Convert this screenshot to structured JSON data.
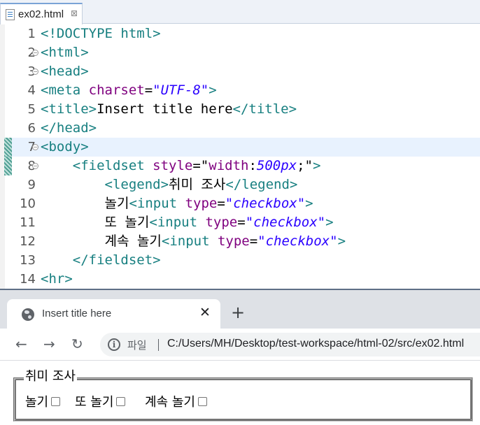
{
  "editor": {
    "file_tab": {
      "name": "ex02.html",
      "close": "⊠"
    },
    "lines": [
      {
        "num": "1",
        "parts": [
          {
            "c": "t-tag",
            "t": "<!DOCTYPE html>"
          }
        ]
      },
      {
        "num": "2",
        "fold": true,
        "parts": [
          {
            "c": "t-tag",
            "t": "<html>"
          }
        ]
      },
      {
        "num": "3",
        "fold": true,
        "parts": [
          {
            "c": "t-tag",
            "t": "<head>"
          }
        ]
      },
      {
        "num": "4",
        "parts": [
          {
            "c": "t-tag",
            "t": "<meta "
          },
          {
            "c": "t-attr",
            "t": "charset"
          },
          {
            "c": "t-plain",
            "t": "="
          },
          {
            "c": "t-val",
            "t": "\"UTF-8\""
          },
          {
            "c": "t-tag",
            "t": ">"
          }
        ]
      },
      {
        "num": "5",
        "parts": [
          {
            "c": "t-tag",
            "t": "<title>"
          },
          {
            "c": "t-txt",
            "t": "Insert title here"
          },
          {
            "c": "t-tag",
            "t": "</title>"
          }
        ]
      },
      {
        "num": "6",
        "parts": [
          {
            "c": "t-tag",
            "t": "</head>"
          }
        ]
      },
      {
        "num": "7",
        "fold": true,
        "current": true,
        "marked": true,
        "parts": [
          {
            "c": "t-tag",
            "t": "<body>"
          }
        ]
      },
      {
        "num": "8",
        "fold": true,
        "marked": true,
        "parts": [
          {
            "c": "t-plain",
            "t": "    "
          },
          {
            "c": "t-tag",
            "t": "<fieldset "
          },
          {
            "c": "t-attr",
            "t": "style"
          },
          {
            "c": "t-plain",
            "t": "=\""
          },
          {
            "c": "t-attr",
            "t": "width"
          },
          {
            "c": "t-plain",
            "t": ":"
          },
          {
            "c": "t-val",
            "t": "500px"
          },
          {
            "c": "t-plain",
            "t": ";\""
          },
          {
            "c": "t-tag",
            "t": ">"
          }
        ]
      },
      {
        "num": "9",
        "parts": [
          {
            "c": "t-plain",
            "t": "        "
          },
          {
            "c": "t-tag",
            "t": "<legend>"
          },
          {
            "c": "t-txt",
            "t": "취미 조사"
          },
          {
            "c": "t-tag",
            "t": "</legend>"
          }
        ]
      },
      {
        "num": "10",
        "parts": [
          {
            "c": "t-plain",
            "t": "        "
          },
          {
            "c": "t-txt",
            "t": "놀기"
          },
          {
            "c": "t-tag",
            "t": "<input "
          },
          {
            "c": "t-attr",
            "t": "type"
          },
          {
            "c": "t-plain",
            "t": "="
          },
          {
            "c": "t-val",
            "t": "\"checkbox\""
          },
          {
            "c": "t-tag",
            "t": ">"
          }
        ]
      },
      {
        "num": "11",
        "parts": [
          {
            "c": "t-plain",
            "t": "        "
          },
          {
            "c": "t-txt",
            "t": "또 놀기"
          },
          {
            "c": "t-tag",
            "t": "<input "
          },
          {
            "c": "t-attr",
            "t": "type"
          },
          {
            "c": "t-plain",
            "t": "="
          },
          {
            "c": "t-val",
            "t": "\"checkbox\""
          },
          {
            "c": "t-tag",
            "t": ">"
          }
        ]
      },
      {
        "num": "12",
        "parts": [
          {
            "c": "t-plain",
            "t": "        "
          },
          {
            "c": "t-txt",
            "t": "계속 놀기"
          },
          {
            "c": "t-tag",
            "t": "<input "
          },
          {
            "c": "t-attr",
            "t": "type"
          },
          {
            "c": "t-plain",
            "t": "="
          },
          {
            "c": "t-val",
            "t": "\"checkbox\""
          },
          {
            "c": "t-tag",
            "t": ">"
          }
        ]
      },
      {
        "num": "13",
        "parts": [
          {
            "c": "t-plain",
            "t": "    "
          },
          {
            "c": "t-tag",
            "t": "</fieldset>"
          }
        ]
      },
      {
        "num": "14",
        "parts": [
          {
            "c": "t-tag",
            "t": "<hr>"
          }
        ]
      }
    ]
  },
  "browser": {
    "tab_title": "Insert title here",
    "tab_close": "✕",
    "new_tab": "+",
    "back": "←",
    "forward": "→",
    "reload": "↻",
    "info_icon": "i",
    "page_label": "파일",
    "url": "C:/Users/MH/Desktop/test-workspace/html-02/src/ex02.html",
    "legend": "취미 조사",
    "options": [
      {
        "label": "놀기",
        "checked": false
      },
      {
        "label": "또 놀기",
        "checked": false
      },
      {
        "label": "계속 놀기",
        "checked": false
      }
    ]
  },
  "colors": {
    "tag": "#177f80",
    "attribute": "#7f007f",
    "value": "#2a00ff",
    "current_line": "#e8f2fe",
    "browser_tabstrip": "#dee1e6"
  }
}
